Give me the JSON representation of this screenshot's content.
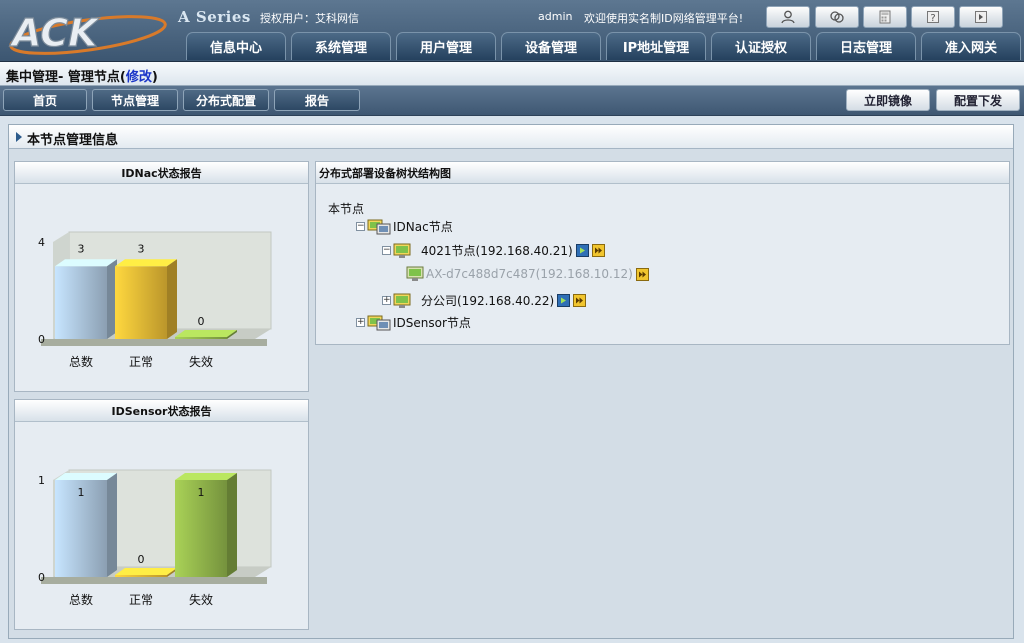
{
  "header": {
    "logo_text": "ACK",
    "series": "A Series",
    "auth_user": "授权用户：艾科网信",
    "admin": "admin",
    "welcome": "欢迎使用实名制ID网络管理平台!",
    "top_icons": [
      "user-icon",
      "refresh-icon",
      "calculator-icon",
      "help-icon",
      "logout-icon"
    ],
    "nav_tabs": [
      "信息中心",
      "系统管理",
      "用户管理",
      "设备管理",
      "IP地址管理",
      "认证授权",
      "日志管理",
      "准入网关"
    ]
  },
  "breadcrumb": {
    "text": "集中管理- 管理节点(",
    "link": "修改",
    "close": ")"
  },
  "subnav": {
    "left": [
      "首页",
      "节点管理",
      "分布式配置",
      "报告"
    ],
    "right": [
      "立即镜像",
      "配置下发"
    ]
  },
  "main": {
    "title": "本节点管理信息"
  },
  "tree_panel": {
    "title": "分布式部署设备树状结构图",
    "root": "本节点",
    "nodes": {
      "idnac": "IDNac节点",
      "n4021": "4021节点(192.168.40.21)",
      "ax": "AX-d7c488d7c487(192.168.10.12)",
      "branch": "分公司(192.168.40.22)",
      "idsensor": "IDSensor节点"
    },
    "toggle_minus": "−",
    "toggle_plus": "+"
  },
  "chart_data": [
    {
      "type": "bar",
      "title": "IDNac状态报告",
      "categories": [
        "总数",
        "正常",
        "失效"
      ],
      "values": [
        3,
        3,
        0
      ],
      "ylim": [
        0,
        4
      ],
      "yticks": [
        0,
        4
      ],
      "colors": [
        "#a9c2d9",
        "#e4b735",
        "#8fb24a"
      ]
    },
    {
      "type": "bar",
      "title": "IDSensor状态报告",
      "categories": [
        "总数",
        "正常",
        "失效"
      ],
      "values": [
        1,
        0,
        1
      ],
      "ylim": [
        0,
        1
      ],
      "yticks": [
        0,
        1
      ],
      "colors": [
        "#a9c2d9",
        "#e4b735",
        "#8fb24a"
      ]
    }
  ]
}
